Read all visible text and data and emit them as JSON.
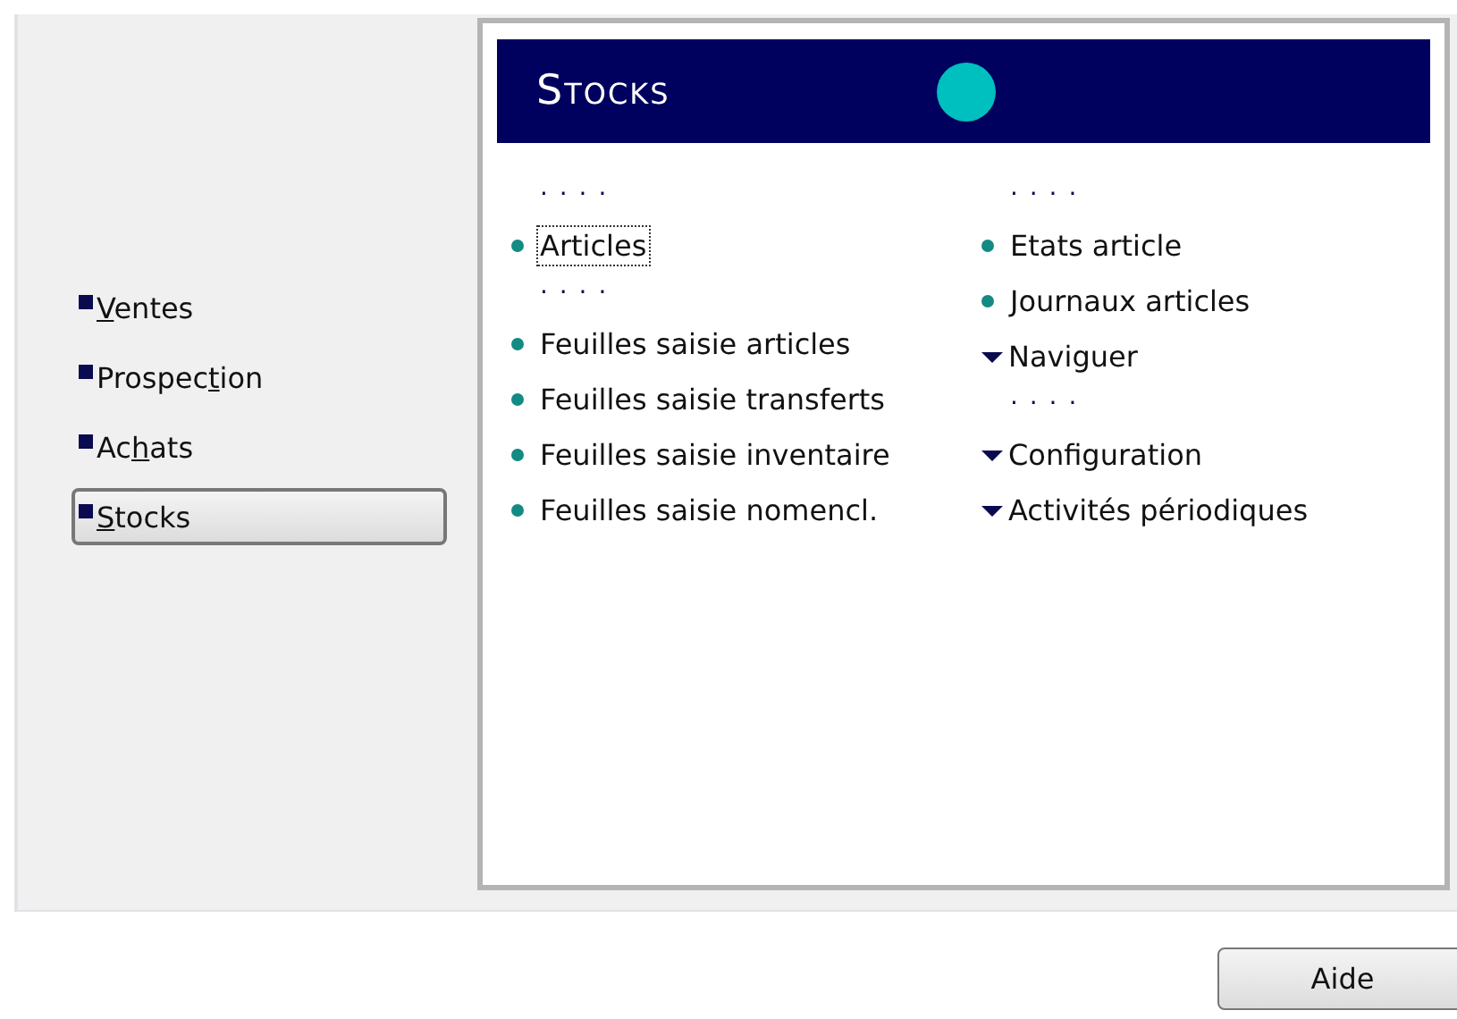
{
  "sidebar": {
    "items": [
      {
        "accel": "V",
        "after": "entes",
        "selected": false
      },
      {
        "before": "Prospec",
        "accel": "t",
        "after": "ion",
        "selected": false
      },
      {
        "before": "Ac",
        "accel": "h",
        "after": "ats",
        "selected": false
      },
      {
        "accel": "S",
        "after": "tocks",
        "selected": true
      }
    ]
  },
  "panel": {
    "title": "Stocks",
    "columns": [
      [
        {
          "kind": "dots",
          "text": ". . . ."
        },
        {
          "kind": "link",
          "text": "Articles",
          "focused": true
        },
        {
          "kind": "dots",
          "text": ". . . ."
        },
        {
          "kind": "link",
          "text": "Feuilles saisie articles",
          "focused": false
        },
        {
          "kind": "link",
          "text": "Feuilles saisie transferts",
          "focused": false
        },
        {
          "kind": "link",
          "text": "Feuilles saisie inventaire",
          "focused": false
        },
        {
          "kind": "link",
          "text": "Feuilles saisie nomencl.",
          "focused": false
        }
      ],
      [
        {
          "kind": "dots",
          "text": ". . . ."
        },
        {
          "kind": "link",
          "text": "Etats article",
          "focused": false
        },
        {
          "kind": "link",
          "text": "Journaux articles",
          "focused": false
        },
        {
          "kind": "menu",
          "text": "Naviguer"
        },
        {
          "kind": "dots",
          "text": ". . . ."
        },
        {
          "kind": "menu",
          "text": "Configuration"
        },
        {
          "kind": "menu",
          "text": "Activités périodiques"
        }
      ]
    ]
  },
  "buttons": [
    "Aide"
  ]
}
